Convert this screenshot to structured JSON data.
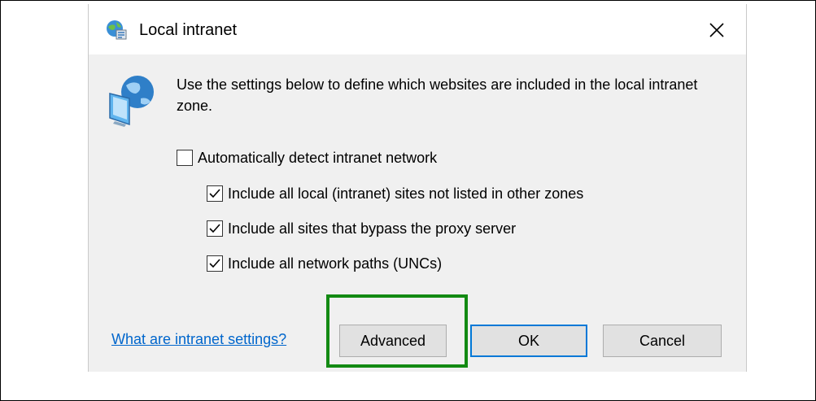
{
  "dialog": {
    "title": "Local intranet",
    "description": "Use the settings below to define which websites are included in the local intranet zone.",
    "checkboxes": [
      {
        "label": "Automatically detect intranet network",
        "checked": false
      },
      {
        "label": "Include all local (intranet) sites not listed in other zones",
        "checked": true
      },
      {
        "label": "Include all sites that bypass the proxy server",
        "checked": true
      },
      {
        "label": "Include all network paths (UNCs)",
        "checked": true
      }
    ],
    "help_link": "What are intranet settings?",
    "buttons": {
      "advanced": "Advanced",
      "ok": "OK",
      "cancel": "Cancel"
    }
  },
  "colors": {
    "highlight": "#138a13",
    "link": "#0066cc",
    "default_button_border": "#0078d7",
    "dialog_background": "#f0f0f0"
  },
  "icons": {
    "title": "globe-network-icon",
    "zone": "globe-monitor-icon",
    "close": "close-icon",
    "check": "checkmark-icon"
  }
}
